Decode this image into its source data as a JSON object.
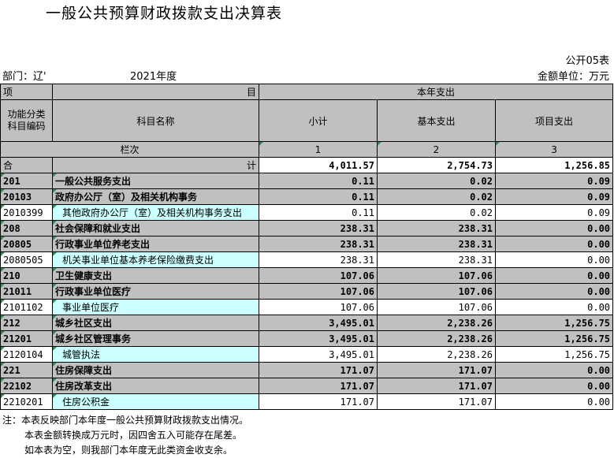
{
  "title": "一般公共预算财政拨款支出决算表",
  "form_code": "公开05表",
  "department": "部门：辽'",
  "year": "2021年度",
  "unit": "金额单位：万元",
  "header": {
    "item_left": "项",
    "item_right": "目",
    "current_expense": "本年支出",
    "func_code": "功能分类\n科目编码",
    "func_code_line1": "功能分类",
    "func_code_line2": "科目编码",
    "subject_name": "科目名称",
    "subtotal": "小计",
    "basic": "基本支出",
    "project": "项目支出",
    "column_order": "栏次",
    "col1": "1",
    "col2": "2",
    "col3": "3"
  },
  "total": {
    "left": "合",
    "right": "计",
    "subtotal": "4,011.57",
    "basic": "2,754.73",
    "project": "1,256.85"
  },
  "rows": [
    {
      "code": "201",
      "name": "一般公共服务支出",
      "subtotal": "0.11",
      "basic": "0.02",
      "project": "0.09",
      "level": 1
    },
    {
      "code": "20103",
      "name": "政府办公厅（室）及相关机构事务",
      "subtotal": "0.11",
      "basic": "0.02",
      "project": "0.09",
      "level": 2
    },
    {
      "code": "2010399",
      "name": "其他政府办公厅（室）及相关机构事务支出",
      "subtotal": "0.11",
      "basic": "0.02",
      "project": "0.09",
      "level": 3
    },
    {
      "code": "208",
      "name": "社会保障和就业支出",
      "subtotal": "238.31",
      "basic": "238.31",
      "project": "0.00",
      "level": 1
    },
    {
      "code": "20805",
      "name": "行政事业单位养老支出",
      "subtotal": "238.31",
      "basic": "238.31",
      "project": "0.00",
      "level": 2
    },
    {
      "code": "2080505",
      "name": "机关事业单位基本养老保险缴费支出",
      "subtotal": "238.31",
      "basic": "238.31",
      "project": "0.00",
      "level": 3
    },
    {
      "code": "210",
      "name": "卫生健康支出",
      "subtotal": "107.06",
      "basic": "107.06",
      "project": "0.00",
      "level": 1
    },
    {
      "code": "21011",
      "name": "行政事业单位医疗",
      "subtotal": "107.06",
      "basic": "107.06",
      "project": "0.00",
      "level": 2
    },
    {
      "code": "2101102",
      "name": "事业单位医疗",
      "subtotal": "107.06",
      "basic": "107.06",
      "project": "0.00",
      "level": 3
    },
    {
      "code": "212",
      "name": "城乡社区支出",
      "subtotal": "3,495.01",
      "basic": "2,238.26",
      "project": "1,256.75",
      "level": 1
    },
    {
      "code": "21201",
      "name": "城乡社区管理事务",
      "subtotal": "3,495.01",
      "basic": "2,238.26",
      "project": "1,256.75",
      "level": 2
    },
    {
      "code": "2120104",
      "name": "城管执法",
      "subtotal": "3,495.01",
      "basic": "2,238.26",
      "project": "1,256.75",
      "level": 3
    },
    {
      "code": "221",
      "name": "住房保障支出",
      "subtotal": "171.07",
      "basic": "171.07",
      "project": "0.00",
      "level": 1
    },
    {
      "code": "22102",
      "name": "住房改革支出",
      "subtotal": "171.07",
      "basic": "171.07",
      "project": "0.00",
      "level": 2
    },
    {
      "code": "2210201",
      "name": "住房公积金",
      "subtotal": "171.07",
      "basic": "171.07",
      "project": "0.00",
      "level": 3
    }
  ],
  "notes": [
    "注：本表反映部门本年度一般公共预算财政拨款支出情况。",
    "本表金额转换成万元时，因四舍五入可能存在尾差。",
    "如本表为空，则我部门本年度无此类资金收支余。"
  ]
}
